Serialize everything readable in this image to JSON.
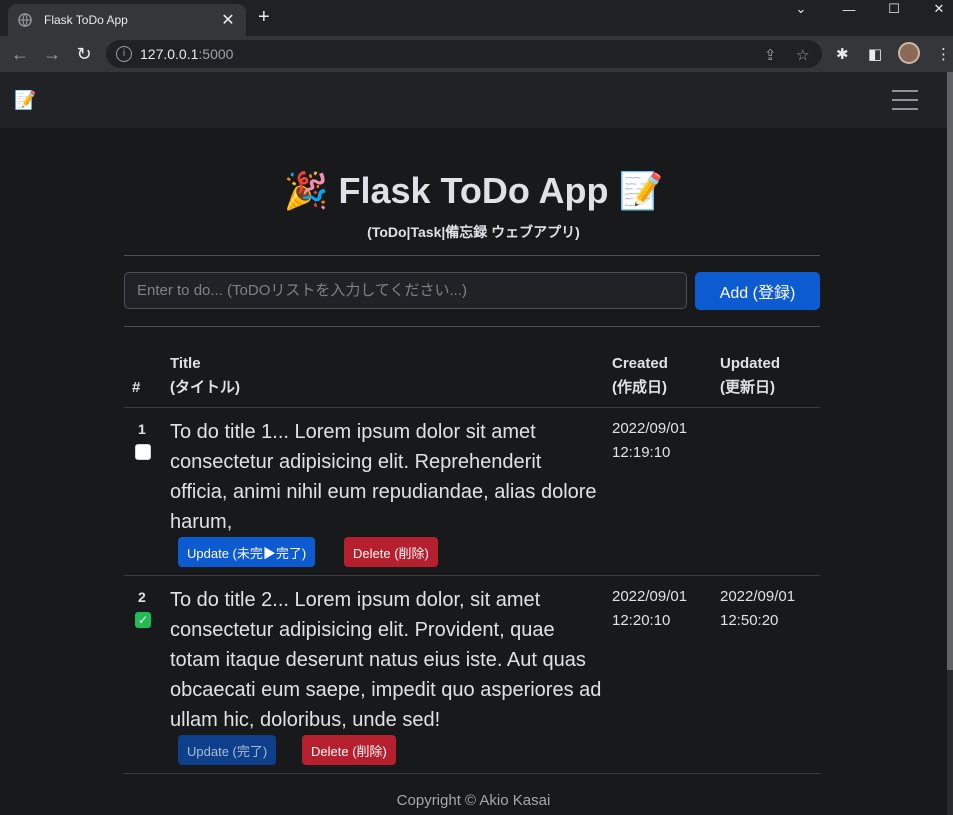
{
  "browser": {
    "tab_title": "Flask ToDo App",
    "url_host": "127.0.0.1",
    "url_port": ":5000"
  },
  "navbar": {
    "brand_icon": "📝"
  },
  "header": {
    "title": "Flask ToDo App",
    "title_prefix": "🎉",
    "title_suffix": "📝",
    "subtitle": "(ToDo|Task|備忘録 ウェブアプリ)"
  },
  "form": {
    "placeholder": "Enter to do... (ToDOリストを入力してください...)",
    "add_label": "Add (登録)"
  },
  "table": {
    "headers": {
      "num": "#",
      "title_line1": "Title",
      "title_line2": "(タイトル)",
      "created_line1": "Created",
      "created_line2": "(作成日)",
      "updated_line1": "Updated",
      "updated_line2": "(更新日)"
    },
    "rows": [
      {
        "num": "1",
        "done": false,
        "text": "To do title 1... Lorem ipsum dolor sit amet consectetur adipisicing elit. Reprehenderit officia, animi nihil eum repudiandae, alias dolore harum,",
        "created_date": "2022/09/01",
        "created_time": "12:19:10",
        "updated_date": "",
        "updated_time": "",
        "update_label": "Update (未完▶完了)",
        "delete_label": "Delete (削除)"
      },
      {
        "num": "2",
        "done": true,
        "text": "To do title 2... Lorem ipsum dolor, sit amet consectetur adipisicing elit. Provident, quae totam itaque deserunt natus eius iste. Aut quas obcaecati eum saepe, impedit quo asperiores ad ullam hic, doloribus, unde sed!",
        "created_date": "2022/09/01",
        "created_time": "12:20:10",
        "updated_date": "2022/09/01",
        "updated_time": "12:50:20",
        "update_label": "Update (完了)",
        "delete_label": "Delete (削除)"
      }
    ]
  },
  "footer": {
    "copyright": "Copyright © Akio Kasai"
  }
}
